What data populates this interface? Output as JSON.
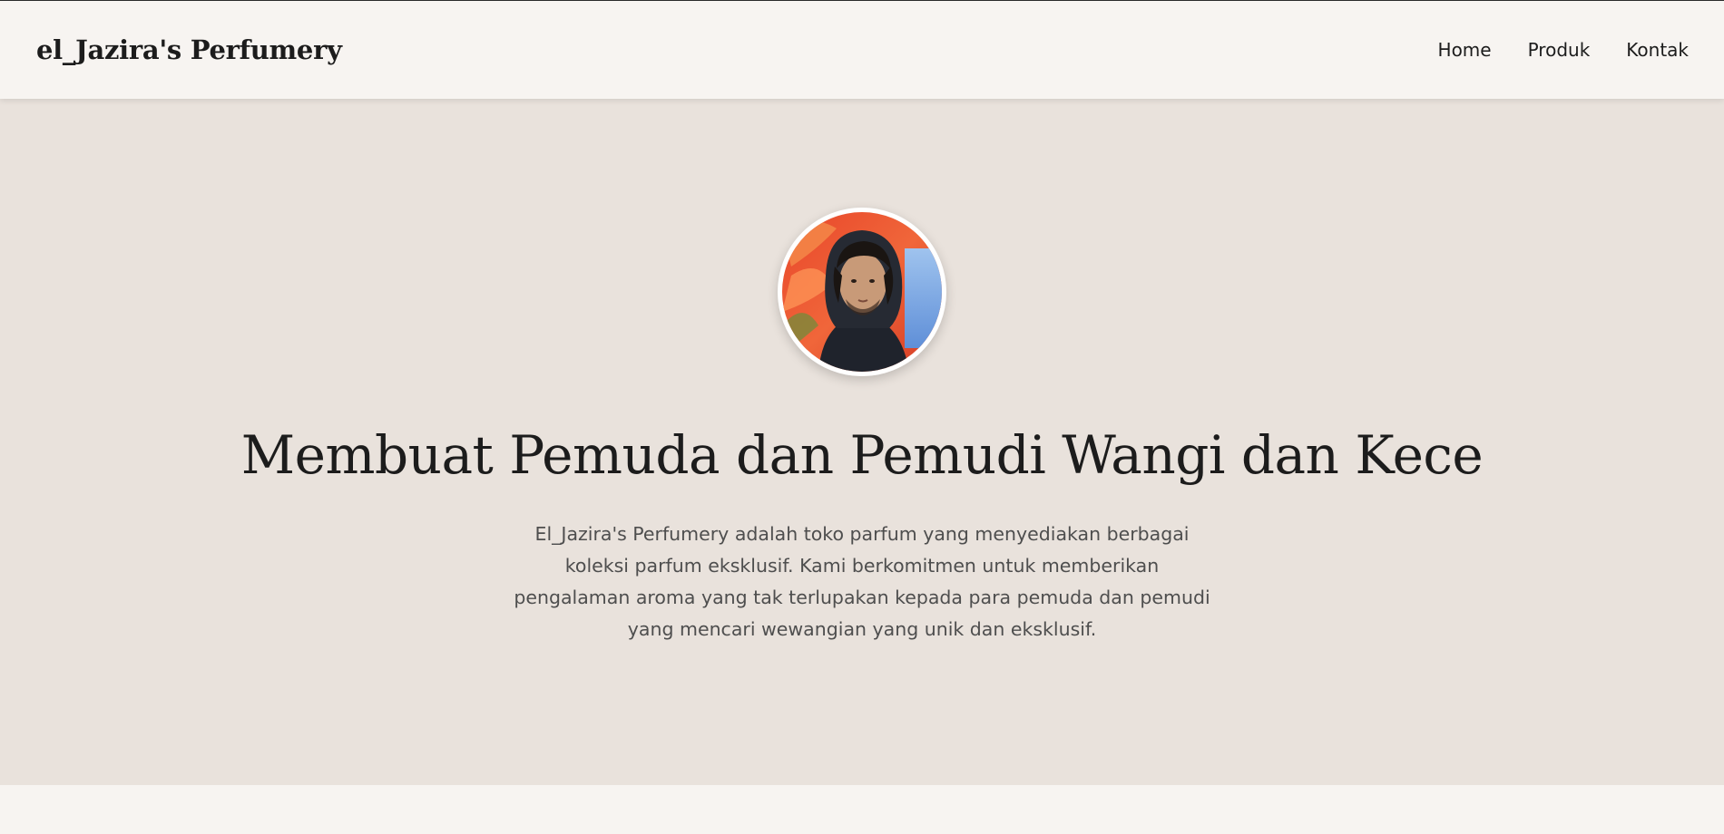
{
  "header": {
    "brand": "el_Jazira's Perfumery",
    "nav": [
      "Home",
      "Produk",
      "Kontak"
    ]
  },
  "hero": {
    "avatar_alt": "profile-photo",
    "title": "Membuat Pemuda dan Pemudi Wangi dan Kece",
    "description": "El_Jazira's Perfumery adalah toko parfum yang menyediakan berbagai koleksi parfum eksklusif. Kami berkomitmen untuk memberikan pengalaman aroma yang tak terlupakan kepada para pemuda dan pemudi yang mencari wewangian yang unik dan eksklusif."
  },
  "colors": {
    "header_bg": "#f7f4f1",
    "hero_bg": "#e9e2dc",
    "title_text": "#1c1c1c",
    "body_text": "#4e4e4e"
  }
}
